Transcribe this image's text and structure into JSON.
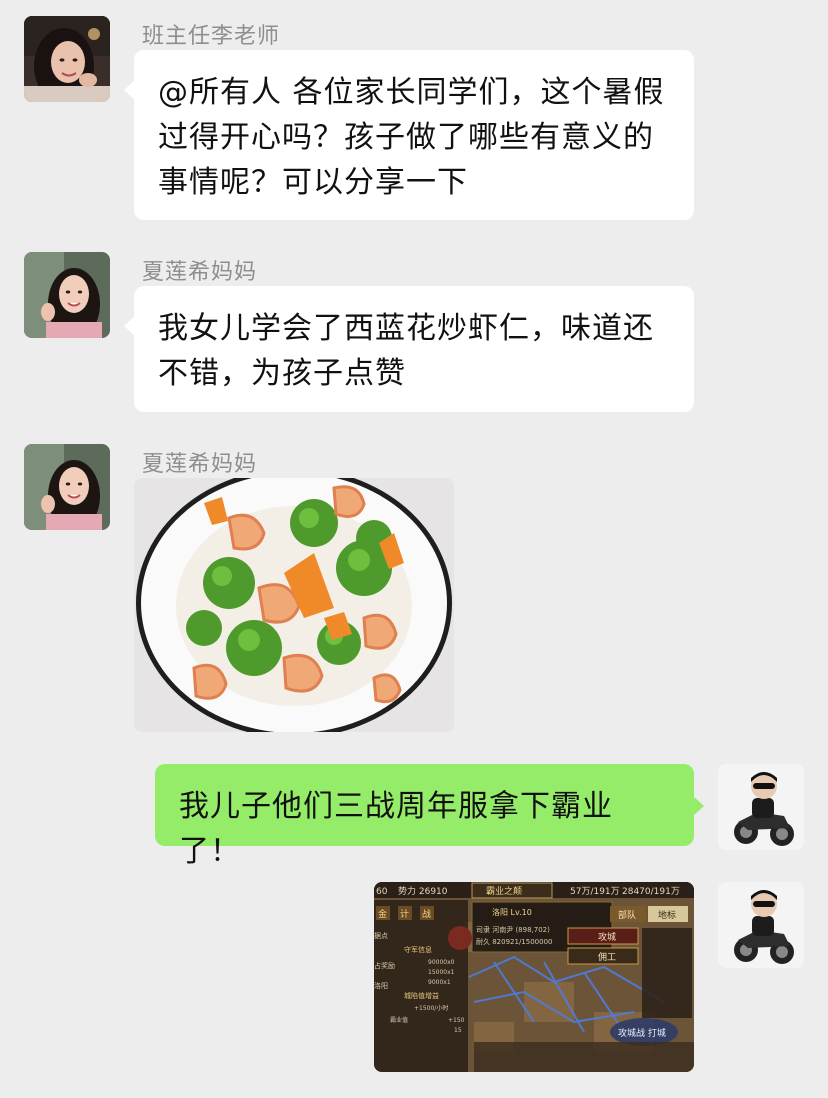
{
  "messages": [
    {
      "sender": "班主任李老师",
      "text": "@所有人 各位家长同学们，这个暑假\n过得开心吗？孩子做了哪些有意义的\n事情呢？可以分享一下"
    },
    {
      "sender": "夏莲希妈妈",
      "text": "我女儿学会了西蓝花炒虾仁，味道还\n不错，为孩子点赞"
    },
    {
      "sender": "夏莲希妈妈",
      "image": "shrimp-broccoli-dish-photo"
    },
    {
      "sender": "",
      "text": "我儿子他们三战周年服拿下霸业了！"
    },
    {
      "sender": "",
      "image": "game-screenshot"
    }
  ],
  "game_screenshot": {
    "title": "霸业之颠",
    "resource_1": "势力 26910",
    "resource_2": "57万/191万",
    "resource_3": "28470/191万",
    "left_label": "60",
    "tab_1": "部队",
    "tab_2": "地标",
    "city": "洛阳 Lv.10",
    "row_1": "司隶 河南尹 (898,702)",
    "row_2": "耐久 820921/1500000",
    "attack_button": "攻城",
    "hire_button": "佣工",
    "badge_1": "金",
    "badge_2": "计",
    "badge_3": "战",
    "side_label_1": "据点",
    "side_label_2": "占奖励",
    "side_label_3": "洛阳",
    "info_1": "守军信息",
    "info_2": "90000x0",
    "info_3": "15000x1",
    "info_4": "9000x1",
    "info_5": "城陷值增益",
    "info_6": "+1500/小时",
    "info_7": "霸业值",
    "info_8": "+150",
    "info_9": "15",
    "footer": "攻城战 打城"
  },
  "colors": {
    "background": "#ededed",
    "incoming_bubble": "#ffffff",
    "outgoing_bubble": "#95ec69",
    "sender_name": "#8e8e8e"
  }
}
